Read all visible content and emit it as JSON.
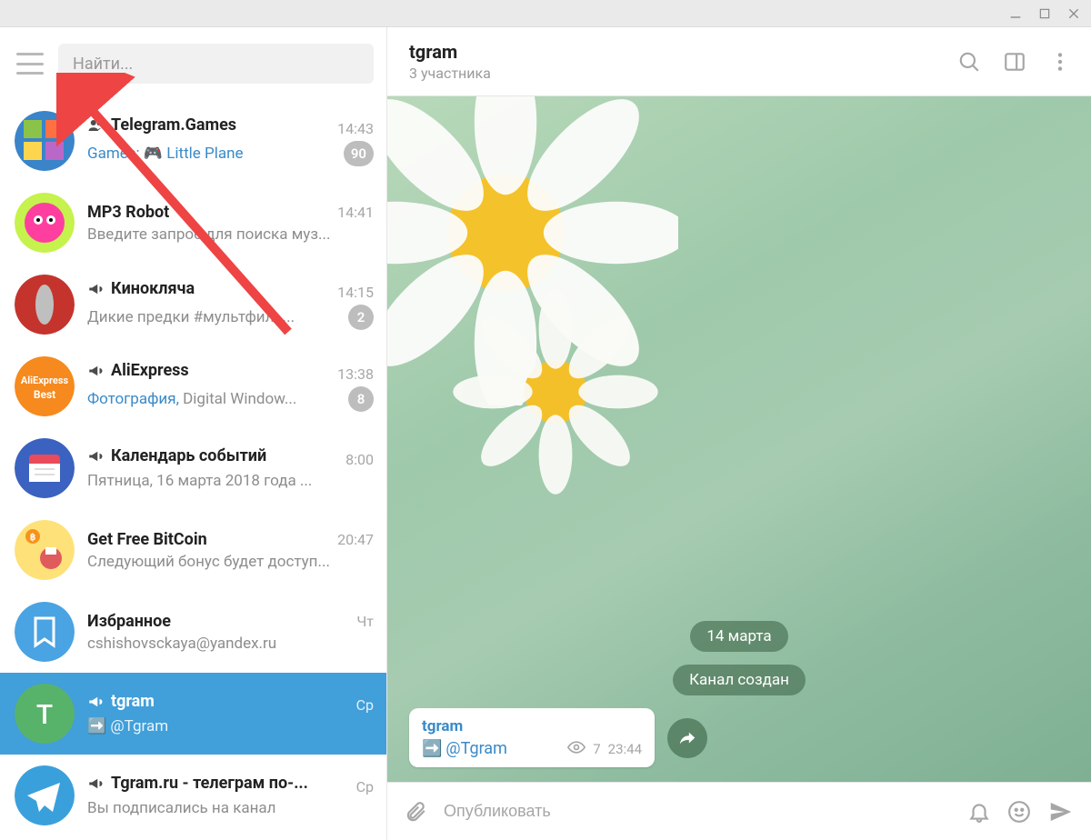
{
  "search": {
    "placeholder": "Найти..."
  },
  "header": {
    "title": "tgram",
    "subtitle": "3 участника"
  },
  "chat_bg": {
    "date_pill": "14 марта",
    "system_pill": "Канал создан"
  },
  "message": {
    "from": "tgram",
    "handle": "@Tgram",
    "views": "7",
    "time": "23:44"
  },
  "composer": {
    "placeholder": "Опубликовать"
  },
  "chats": [
    {
      "type": "group",
      "title": "Telegram.Games",
      "time": "14:43",
      "sender": "Games:",
      "preview_suffix": " Little Plane",
      "joystick": "🎮",
      "badge": "90",
      "avatar": "collage"
    },
    {
      "type": "bot",
      "title": "MP3 Robot",
      "time": "14:41",
      "preview": "Введите запрос для поиска муз...",
      "avatar": "pinkmonster"
    },
    {
      "type": "channel",
      "title": "Кинокляча",
      "time": "14:15",
      "preview": "Дикие предки  #мультфиль...",
      "badge": "2",
      "avatar": "redcircle"
    },
    {
      "type": "channel",
      "title": "AliExpress",
      "time": "13:38",
      "media_prefix": "Фотография,",
      "preview_suffix": " Digital Window...",
      "badge": "8",
      "avatar": "aliexpress"
    },
    {
      "type": "channel",
      "title": "Календарь событий",
      "time": "8:00",
      "preview": "Пятница, 16 марта 2018 года  ...",
      "avatar": "calendar"
    },
    {
      "type": "bot",
      "title": "Get Free BitCoin",
      "time": "20:47",
      "preview": "Следующий бонус будет доступ...",
      "avatar": "bitcoin"
    },
    {
      "type": "saved",
      "title": "Избранное",
      "time": "Чт",
      "preview": "cshishovsckaya@yandex.ru",
      "avatar": "saved"
    },
    {
      "type": "channel",
      "title": "tgram",
      "time": "Ср",
      "arrow_prefix": "➡️",
      "preview_suffix": "@Tgram",
      "avatar": "tgram",
      "avatar_letter": "T",
      "active": true
    },
    {
      "type": "channel",
      "title": "Tgram.ru - телеграм по-...",
      "time": "Ср",
      "preview": "Вы подписались на канал",
      "avatar": "telegram"
    }
  ]
}
